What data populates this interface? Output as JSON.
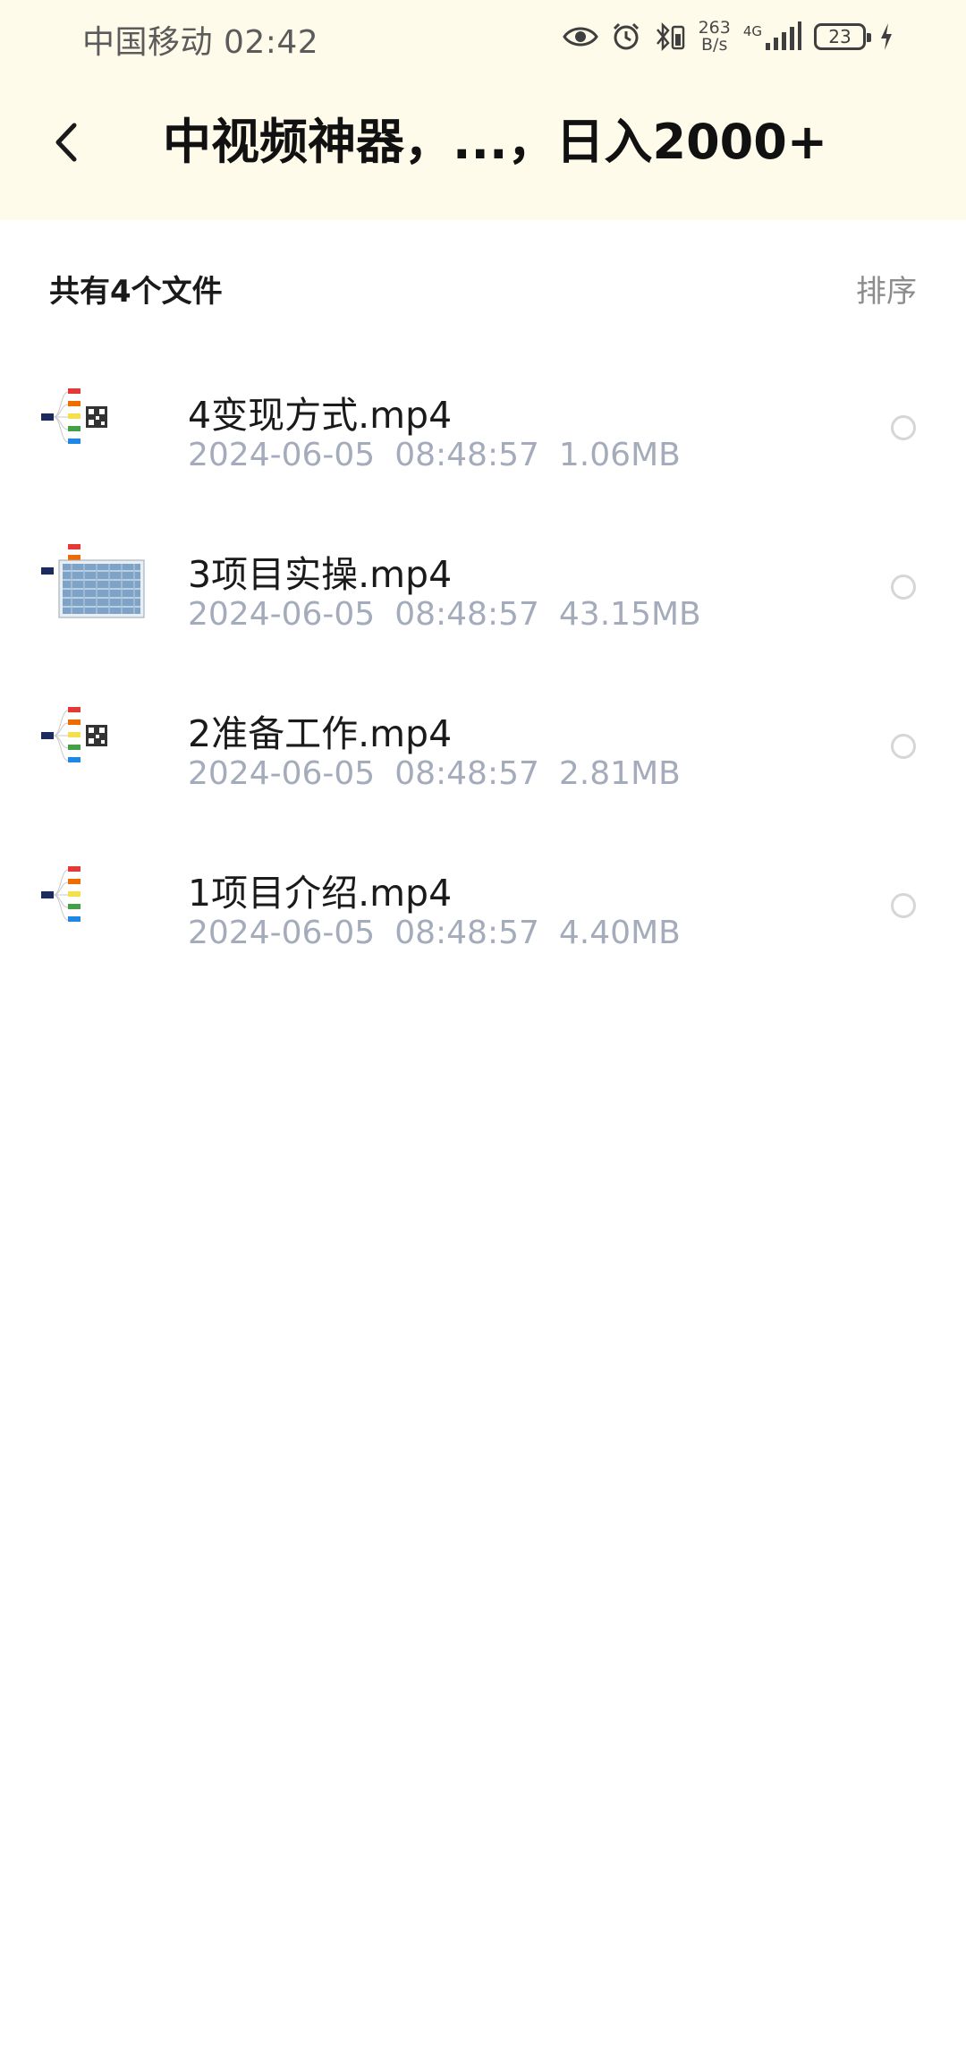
{
  "status_bar": {
    "carrier": "中国移动",
    "time": "02:42",
    "net_speed_value": "263",
    "net_speed_unit": "B/s",
    "network": "4G",
    "battery": "23",
    "icons": [
      "eye-icon",
      "alarm-icon",
      "bluetooth-icon",
      "signal-icon",
      "battery-icon",
      "charging-icon"
    ]
  },
  "header": {
    "title": "中视频神器，...，日入2000+"
  },
  "summary": {
    "count_text": "共有4个文件",
    "sort_label": "排序"
  },
  "files": [
    {
      "name": "4变现方式.mp4",
      "date": "2024-06-05",
      "time": "08:48:57",
      "size": "1.06MB",
      "thumb": "mindmap-qr"
    },
    {
      "name": "3项目实操.mp4",
      "date": "2024-06-05",
      "time": "08:48:57",
      "size": "43.15MB",
      "thumb": "mindmap-screenshot"
    },
    {
      "name": "2准备工作.mp4",
      "date": "2024-06-05",
      "time": "08:48:57",
      "size": "2.81MB",
      "thumb": "mindmap-qr"
    },
    {
      "name": "1项目介绍.mp4",
      "date": "2024-06-05",
      "time": "08:48:57",
      "size": "4.40MB",
      "thumb": "mindmap"
    }
  ],
  "colors": {
    "header_bg": "#fffbea",
    "meta_text": "#a4abbb",
    "sort_text": "#8c8c8c"
  }
}
